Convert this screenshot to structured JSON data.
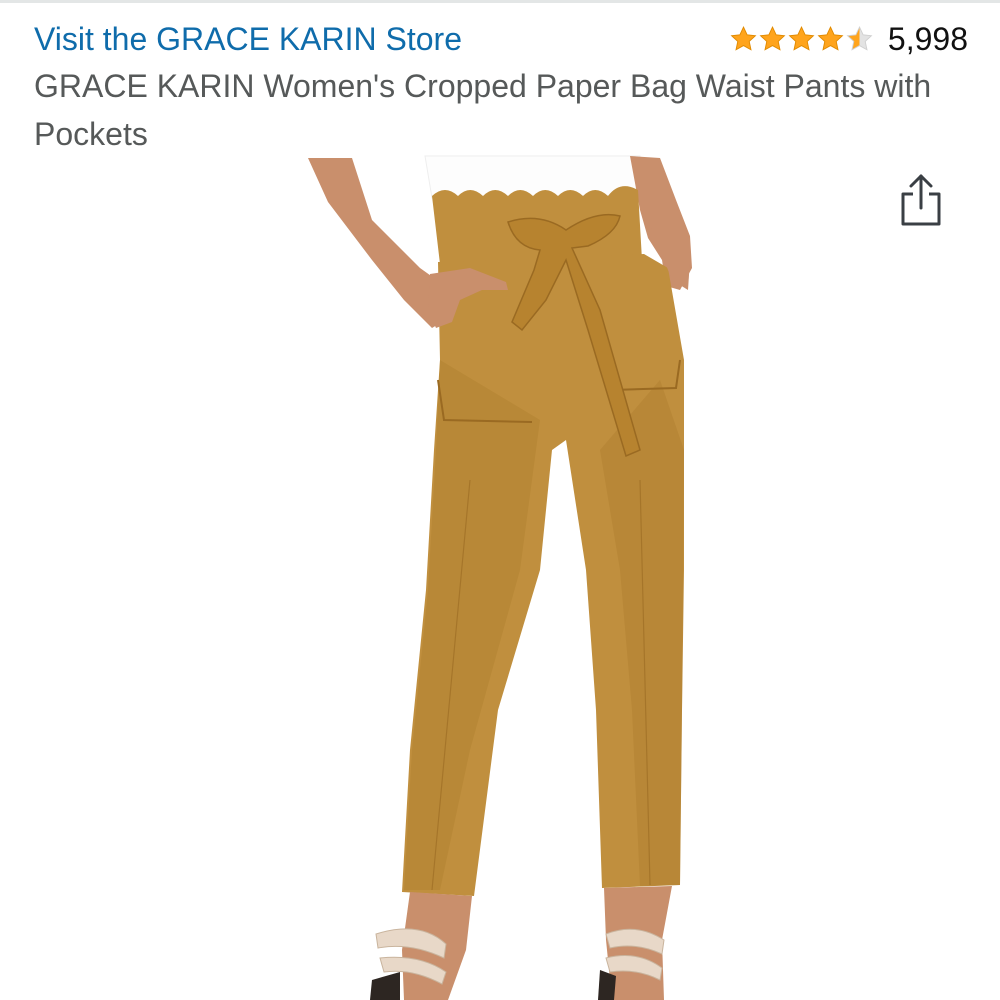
{
  "header": {
    "store_link": "Visit the GRACE KARIN Store",
    "rating_count": "5,998",
    "rating_stars": 4.5
  },
  "product": {
    "title": "GRACE KARIN Women's Cropped Paper Bag Waist Pants with Pockets"
  },
  "icons": {
    "share": "share-icon",
    "star": "star-icon"
  },
  "colors": {
    "link": "#0f6cab",
    "star_fill": "#ffa41c",
    "star_empty": "#e3e3e3",
    "title_text": "#565959",
    "pants": "#c08f3e"
  }
}
